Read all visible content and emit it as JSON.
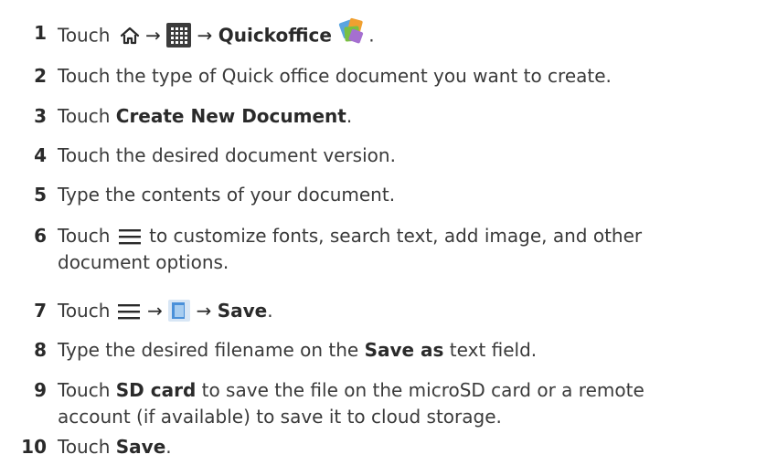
{
  "steps": [
    {
      "num": "1",
      "t1": "Touch",
      "t2": "→",
      "t3": "→",
      "bold": "Quickoffice",
      "t4": "."
    },
    {
      "num": "2",
      "text": "Touch the type of Quick office document you want to create."
    },
    {
      "num": "3",
      "t1": "Touch ",
      "bold": "Create New Document",
      "t2": "."
    },
    {
      "num": "4",
      "text": "Touch the desired document version."
    },
    {
      "num": "5",
      "text": "Type the contents of your document."
    },
    {
      "num": "6",
      "t1": "Touch",
      "t2": "to customize fonts, search text, add image, and other",
      "t3": "document options."
    },
    {
      "num": "7",
      "t1": "Touch",
      "t2": "→",
      "t3": "→",
      "bold": "Save",
      "t4": "."
    },
    {
      "num": "8",
      "t1": "Type the desired filename on the ",
      "bold": "Save as",
      "t2": " text field."
    },
    {
      "num": "9",
      "t1": "Touch ",
      "bold": "SD card",
      "t2": " to save the file on the microSD card or a remote",
      "t3": "account (if available) to save it to cloud storage."
    },
    {
      "num": "10",
      "t1": "Touch ",
      "bold": "Save",
      "t2": "."
    }
  ],
  "icons": {
    "home": "home-icon",
    "apps": "apps-grid-icon",
    "quickoffice": "quickoffice-app-icon",
    "menu": "menu-icon",
    "save_doc": "save-document-icon"
  },
  "colors": {
    "text": "#3a3a3a",
    "apps_icon_bg": "#3c3c3c",
    "save_icon": "#4a90d9"
  }
}
